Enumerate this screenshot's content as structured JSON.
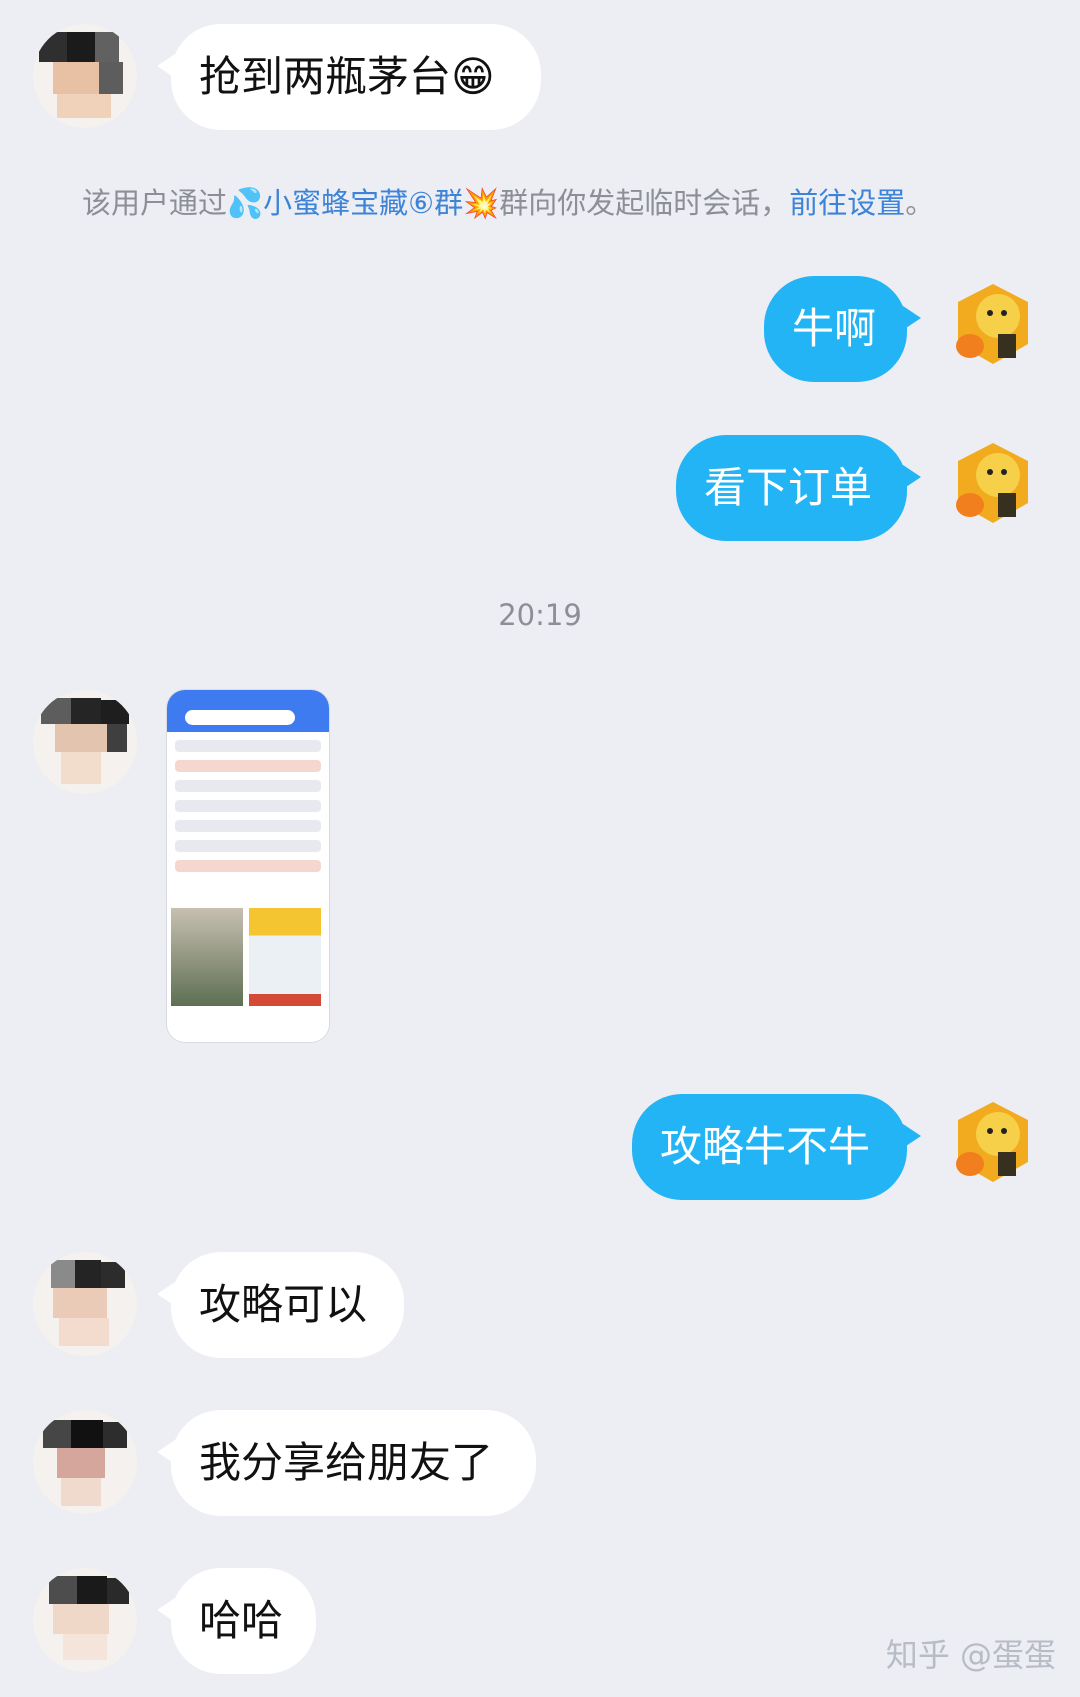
{
  "messages": [
    {
      "side": "in",
      "text": "抢到两瓶茅台😁"
    },
    {
      "side": "out",
      "text": "牛啊"
    },
    {
      "side": "out",
      "text": "看下订单"
    },
    {
      "side": "in",
      "type": "image",
      "description": "Screenshot of order list"
    },
    {
      "side": "out",
      "text": "攻略牛不牛"
    },
    {
      "side": "in",
      "text": "攻略可以"
    },
    {
      "side": "in",
      "text": "我分享给朋友了"
    },
    {
      "side": "in",
      "text": "哈哈"
    }
  ],
  "notice": {
    "prefix": "该用户通过💦",
    "group_name": "小蜜蜂宝藏⑥群",
    "emoji": "💥",
    "suffix": "群向你发起临时会话，",
    "link": "前往设置",
    "end": "。"
  },
  "timestamp": "20:19",
  "watermark": "知乎 @蛋蛋"
}
